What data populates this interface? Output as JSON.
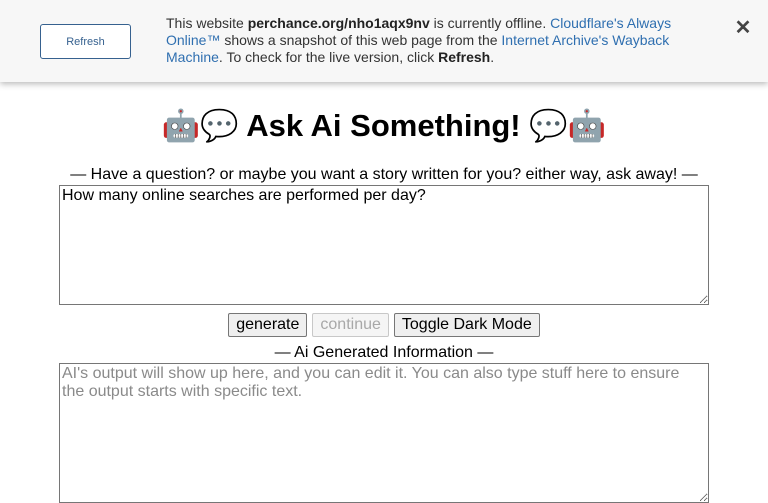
{
  "banner": {
    "refresh_button": "Refresh",
    "text_1": "This website ",
    "site": "perchance.org/nho1aqx9nv",
    "text_2": " is currently offline. ",
    "link_always_online": "Cloudflare's Always Online™",
    "text_3": " shows a snapshot of this web page from the ",
    "link_wayback": "Internet Archive's Wayback Machine",
    "text_4": ". To check for the live version, click ",
    "refresh_word": "Refresh",
    "text_5": ".",
    "close_glyph": "✕"
  },
  "page": {
    "title": "🤖💬 Ask Ai Something! 💬🤖",
    "prompt_label": "— Have a question? or maybe you want a story written for you? either way, ask away! —",
    "prompt_value": "How many online searches are performed per day?",
    "buttons": {
      "generate": "generate",
      "continue": "continue",
      "dark_mode": "Toggle Dark Mode"
    },
    "output_label": "— Ai Generated Information —",
    "output_placeholder": "AI's output will show up here, and you can edit it. You can also type stuff here to ensure the output starts with specific text."
  }
}
